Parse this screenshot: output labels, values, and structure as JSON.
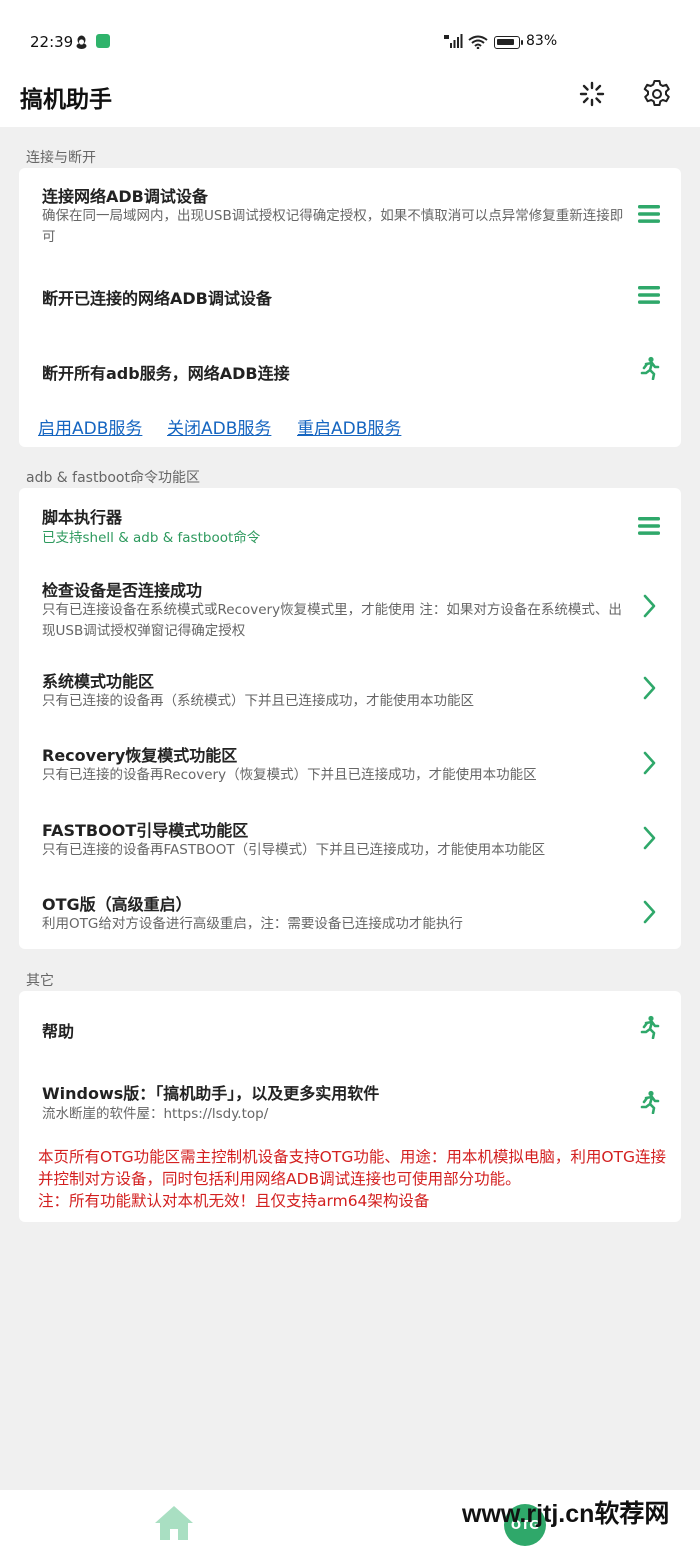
{
  "status_bar": {
    "time": "22:39",
    "battery": "83%",
    "signal_tag": "HD"
  },
  "app_bar": {
    "title": "搞机助手"
  },
  "sections": [
    {
      "label": "连接与断开",
      "items": [
        {
          "title": "连接网络ADB调试设备",
          "desc": "确保在同一局域网内，出现USB调试授权记得确定授权，如果不慎取消可以点异常修复重新连接即可",
          "icon": "menu-icon"
        },
        {
          "title": "断开已连接的网络ADB调试设备",
          "desc": "",
          "icon": "menu-icon"
        },
        {
          "title": "断开所有adb服务，网络ADB连接",
          "desc": "",
          "icon": "run-icon"
        }
      ],
      "links": [
        "启用ADB服务",
        "关闭ADB服务",
        "重启ADB服务"
      ]
    },
    {
      "label": "adb & fastboot命令功能区",
      "items": [
        {
          "title": "脚本执行器",
          "desc": "已支持shell & adb & fastboot命令",
          "icon": "menu-icon"
        },
        {
          "title": "检查设备是否连接成功",
          "desc": "只有已连接设备在系统模式或Recovery恢复模式里，才能使用 注：如果对方设备在系统模式、出现USB调试授权弹窗记得确定授权",
          "icon": "chevron-right-icon"
        },
        {
          "title": "系统模式功能区",
          "desc": "只有已连接的设备再（系统模式）下并且已连接成功，才能使用本功能区",
          "icon": "chevron-right-icon"
        },
        {
          "title": "Recovery恢复模式功能区",
          "desc": "只有已连接的设备再Recovery（恢复模式）下并且已连接成功，才能使用本功能区",
          "icon": "chevron-right-icon"
        },
        {
          "title": "FASTBOOT引导模式功能区",
          "desc": "只有已连接的设备再FASTBOOT（引导模式）下并且已连接成功，才能使用本功能区",
          "icon": "chevron-right-icon"
        },
        {
          "title": "OTG版（高级重启）",
          "desc": "利用OTG给对方设备进行高级重启，注：需要设备已连接成功才能执行",
          "icon": "chevron-right-icon"
        }
      ]
    },
    {
      "label": "其它",
      "items": [
        {
          "title": "帮助",
          "desc": "",
          "icon": "run-icon"
        },
        {
          "title": "Windows版：「搞机助手」，以及更多实用软件",
          "desc": "流水断崖的软件屋：https://lsdy.top/",
          "icon": "run-icon"
        }
      ],
      "warning": "本页所有OTG功能区需主控制机设备支持OTG功能、用途：用本机模拟电脑，利用OTG连接并控制对方设备，同时包括利用网络ADB调试连接也可使用部分功能。\n注：所有功能默认对本机无效！且仅支持arm64架构设备"
    }
  ],
  "bottom_nav": {
    "otg_label": "OTG"
  },
  "watermark": "www.rjtj.cn软荐网",
  "colors": {
    "accent": "#2fa86a",
    "link": "#1565c0",
    "warning": "#d32020"
  }
}
